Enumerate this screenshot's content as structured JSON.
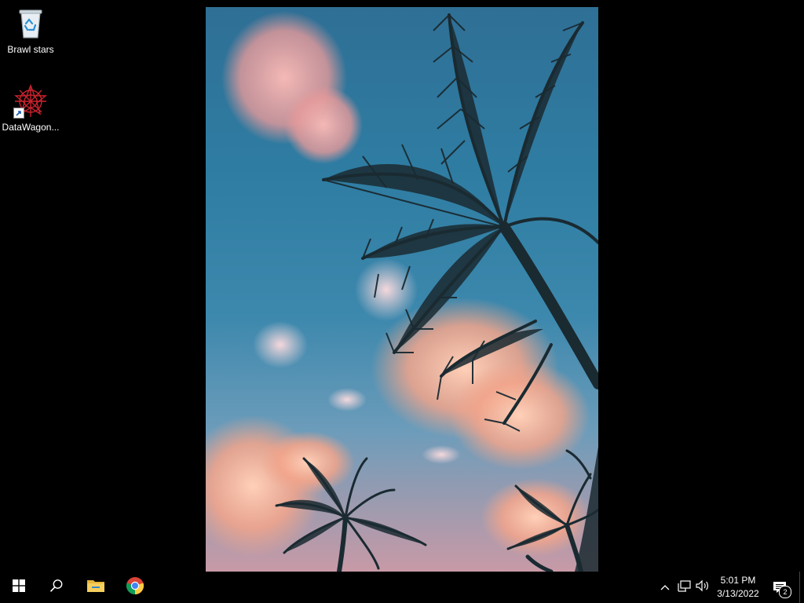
{
  "desktop": {
    "icons": [
      {
        "label": "Brawl stars",
        "icon": "recycle-bin-icon"
      },
      {
        "label": "DataWagon...",
        "icon": "datawagon-icon"
      }
    ],
    "wallpaper": "palm-trees-sunset-sky"
  },
  "taskbar": {
    "start": "windows-start-icon",
    "search": "search-icon",
    "pinned": [
      {
        "name": "File Explorer",
        "icon": "folder-icon"
      },
      {
        "name": "Google Chrome",
        "icon": "chrome-icon"
      }
    ],
    "tray": {
      "overflow": "chevron-up-icon",
      "network": "network-icon",
      "volume": "speaker-icon"
    },
    "clock": {
      "time": "5:01 PM",
      "date": "3/13/2022"
    },
    "notifications": {
      "count": "2"
    }
  },
  "colors": {
    "taskbar_bg": "#000000",
    "desktop_bg": "#000000",
    "folder_yellow": "#e8b53a"
  }
}
